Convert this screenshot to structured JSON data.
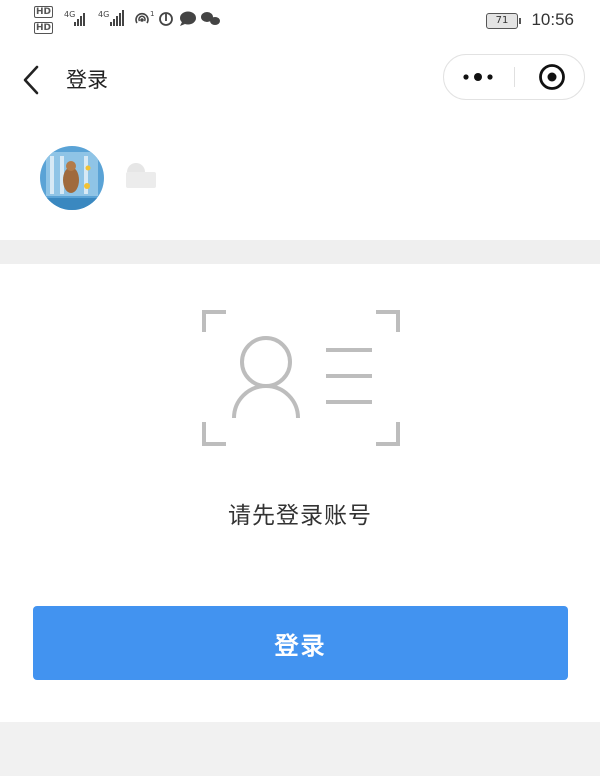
{
  "status_bar": {
    "sim1_label": "HD",
    "sim2_label": "HD",
    "network_1": "4G",
    "network_2": "4G",
    "battery_level": "71",
    "time": "10:56",
    "icons": [
      "signal-icon",
      "signal-icon",
      "hotspot-icon",
      "netease-music-icon",
      "chat-bubble-icon",
      "wechat-icon",
      "battery-icon"
    ]
  },
  "nav": {
    "title": "登录",
    "back_icon": "chevron-left-icon",
    "more_icon": "more-dots-icon",
    "close_icon": "miniprogram-close-icon"
  },
  "profile": {
    "avatar_icon": "user-avatar-photo",
    "nickname": ""
  },
  "login_card": {
    "illustration_icon": "id-card-scan-icon",
    "prompt": "请先登录账号",
    "login_button_label": "登录"
  },
  "colors": {
    "primary_button": "#4293f0",
    "page_background": "#f1f1f1",
    "illustration_gray": "#bdbdbd"
  }
}
